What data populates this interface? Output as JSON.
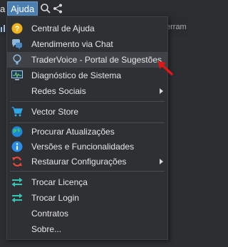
{
  "menubar": {
    "prev_label_fragment": "a",
    "active_menu": "Ajuda"
  },
  "background": {
    "ghost_text": "erram"
  },
  "menu": {
    "items": [
      {
        "label": "Central de Ajuda",
        "icon": "help-icon"
      },
      {
        "label": "Atendimento via Chat",
        "icon": "chat-icon"
      },
      {
        "label": "TraderVoice - Portal de Sugestões",
        "icon": "lightbulb-icon"
      },
      {
        "label": "Diagnóstico de Sistema",
        "icon": "monitor-icon"
      },
      {
        "label": "Redes Sociais",
        "icon": "",
        "submenu": true
      },
      {
        "label": "Vector Store",
        "icon": "cart-icon"
      },
      {
        "label": "Procurar Atualizações",
        "icon": "globe-icon"
      },
      {
        "label": "Versões e Funcionalidades",
        "icon": "info-icon"
      },
      {
        "label": "Restaurar Configurações",
        "icon": "refresh-icon",
        "submenu": true
      },
      {
        "label": "Trocar Licença",
        "icon": "swap-icon"
      },
      {
        "label": "Trocar Login",
        "icon": "swap-icon"
      },
      {
        "label": "Contratos",
        "icon": ""
      },
      {
        "label": "Sobre...",
        "icon": ""
      }
    ]
  },
  "colors": {
    "accent": "#4a7fb0",
    "highlight_row": "#3f4348",
    "pointer_arrow": "#e01515"
  }
}
